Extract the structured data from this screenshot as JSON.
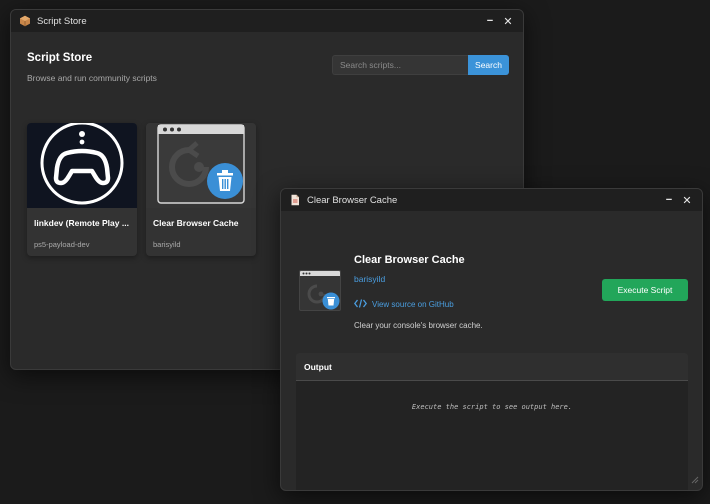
{
  "store_window": {
    "title": "Script Store",
    "minimize": "−",
    "close": "✕",
    "heading": "Script Store",
    "subtitle": "Browse and run community scripts",
    "search": {
      "placeholder": "Search scripts...",
      "button": "Search"
    },
    "cards": [
      {
        "name": "linkdev (Remote Play ...",
        "author": "ps5-payload-dev",
        "icon": "gamepad-icon"
      },
      {
        "name": "Clear Browser Cache",
        "author": "barisyild",
        "icon": "clear-cache-icon"
      }
    ]
  },
  "detail_window": {
    "title": "Clear Browser Cache",
    "minimize": "−",
    "close": "✕",
    "script_name": "Clear Browser Cache",
    "author": "barisyild",
    "source_link": "View source on GitHub",
    "description": "Clear your console's browser cache.",
    "execute_button": "Execute Script",
    "output": {
      "label": "Output",
      "placeholder": "Execute the script to see output here."
    }
  },
  "colors": {
    "accent_blue": "#3b93d9",
    "link_blue": "#4a9ee0",
    "execute_green": "#22a65a",
    "trash_blue": "#3a8fd6"
  }
}
